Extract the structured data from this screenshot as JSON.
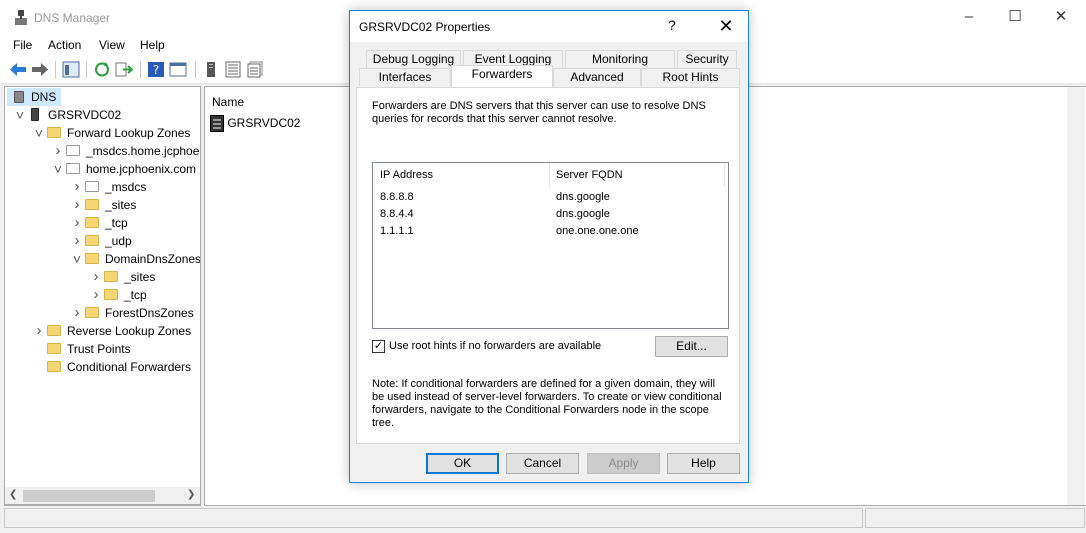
{
  "app": {
    "title": "DNS Manager"
  },
  "menu": [
    "File",
    "Action",
    "View",
    "Help"
  ],
  "tree": {
    "items": [
      {
        "label": "DNS",
        "depth": 0,
        "chev": "",
        "icon": "dns-icon",
        "selected": true
      },
      {
        "label": "GRSRVDC02",
        "depth": 1,
        "chev": "open",
        "icon": "server-icon"
      },
      {
        "label": "Forward Lookup Zones",
        "depth": 2,
        "chev": "open",
        "icon": "folder-icon"
      },
      {
        "label": "_msdcs.home.jcphoenix.com",
        "depth": 3,
        "chev": "closed",
        "icon": "zone-icon"
      },
      {
        "label": "home.jcphoenix.com",
        "depth": 3,
        "chev": "open",
        "icon": "zone-icon"
      },
      {
        "label": "_msdcs",
        "depth": 4,
        "chev": "closed",
        "icon": "zone-icon"
      },
      {
        "label": "_sites",
        "depth": 4,
        "chev": "closed",
        "icon": "folder-icon"
      },
      {
        "label": "_tcp",
        "depth": 4,
        "chev": "closed",
        "icon": "folder-icon"
      },
      {
        "label": "_udp",
        "depth": 4,
        "chev": "closed",
        "icon": "folder-icon"
      },
      {
        "label": "DomainDnsZones",
        "depth": 4,
        "chev": "open",
        "icon": "folder-icon"
      },
      {
        "label": "_sites",
        "depth": 5,
        "chev": "closed",
        "icon": "folder-icon"
      },
      {
        "label": "_tcp",
        "depth": 5,
        "chev": "closed",
        "icon": "folder-icon"
      },
      {
        "label": "ForestDnsZones",
        "depth": 4,
        "chev": "closed",
        "icon": "folder-icon"
      },
      {
        "label": "Reverse Lookup Zones",
        "depth": 2,
        "chev": "closed",
        "icon": "folder-icon"
      },
      {
        "label": "Trust Points",
        "depth": 2,
        "chev": "",
        "icon": "folder-icon"
      },
      {
        "label": "Conditional Forwarders",
        "depth": 2,
        "chev": "",
        "icon": "folder-icon"
      }
    ]
  },
  "list": {
    "column": "Name",
    "rows": [
      "GRSRVDC02"
    ]
  },
  "dialog": {
    "title": "GRSRVDC02 Properties",
    "help_glyph": "?",
    "close_glyph": "✕",
    "tabs_row1": [
      "Debug Logging",
      "Event Logging",
      "Monitoring",
      "Security"
    ],
    "tabs_row2": [
      "Interfaces",
      "Forwarders",
      "Advanced",
      "Root Hints"
    ],
    "active_tab": "Forwarders",
    "description": "Forwarders are DNS servers that this server can use to resolve DNS queries for records that this server cannot resolve.",
    "table": {
      "headers": [
        "IP Address",
        "Server FQDN"
      ],
      "rows": [
        {
          "ip": "8.8.8.8",
          "fqdn": "dns.google"
        },
        {
          "ip": "8.8.4.4",
          "fqdn": "dns.google"
        },
        {
          "ip": "1.1.1.1",
          "fqdn": "one.one.one.one"
        }
      ]
    },
    "use_root_hints_label": "Use root hints if no forwarders are available",
    "use_root_hints_checked": true,
    "edit_label": "Edit...",
    "note": "Note: If conditional forwarders are defined for a given domain, they will be used instead of server-level forwarders.  To create or view conditional forwarders, navigate to the Conditional Forwarders node in the scope tree.",
    "buttons": {
      "ok": "OK",
      "cancel": "Cancel",
      "apply": "Apply",
      "help": "Help"
    }
  },
  "colors": {
    "accent": "#0078d7",
    "selection": "#cde8ff",
    "folder": "#f5d675"
  }
}
